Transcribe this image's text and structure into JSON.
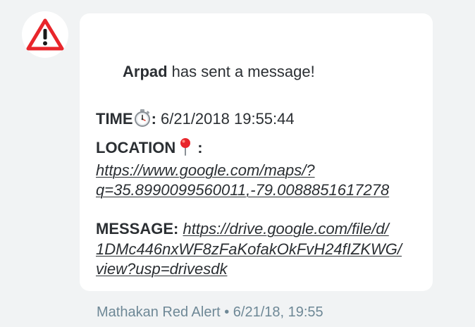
{
  "sender": {
    "name": "Arpad",
    "headline_suffix": " has sent a message!",
    "avatar_icon": "warning-triangle-icon"
  },
  "fields": {
    "time_label": "TIME",
    "time_icon": "stopwatch-icon",
    "time_colon": ":",
    "time_value": " 6/21/2018 19:55:44",
    "location_label": "LOCATION",
    "location_icon": "round-pushpin-icon",
    "location_colon": ":",
    "location_link_line1": "https://www.google.com/maps/?",
    "location_link_line2": "q=35.8990099560011,-79.0088851617278",
    "message_label": "MESSAGE:",
    "message_link_line1": "https://drive.google.com/file/d/",
    "message_link_line2": "1DMc446nxWF8zFaKofakOkFvH24fIZKWG/",
    "message_link_line3": "view?usp=drivesdk"
  },
  "meta": {
    "text": "Mathakan Red Alert • 6/21/18, 19:55"
  },
  "colors": {
    "background": "#f1f3f4",
    "bubble": "#ffffff",
    "text": "#2b2f33",
    "meta_text": "#6e8896",
    "warning_red": "#e8262b"
  }
}
